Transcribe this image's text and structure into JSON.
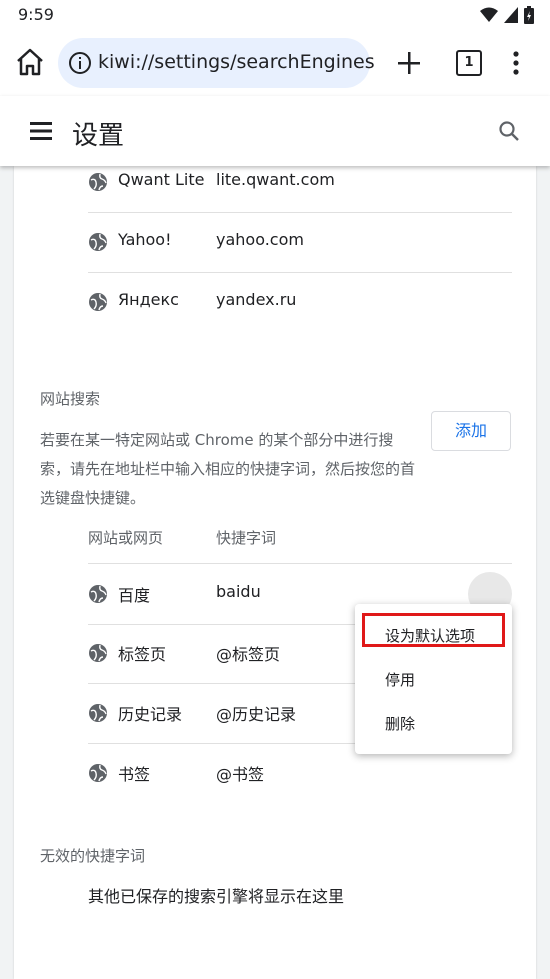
{
  "status_bar": {
    "time": "9:59"
  },
  "toolbar": {
    "url": "kiwi://settings/searchEngines",
    "tab_count": "1"
  },
  "appbar": {
    "title": "设置"
  },
  "default_engines": [
    {
      "name": "Qwant Lite",
      "keyword": "lite.qwant.com"
    },
    {
      "name": "Yahoo!",
      "keyword": "yahoo.com"
    },
    {
      "name": "Яндекс",
      "keyword": "yandex.ru"
    }
  ],
  "site_search": {
    "title": "网站搜索",
    "description": "若要在某一特定网站或 Chrome 的某个部分中进行搜索，请先在地址栏中输入相应的快捷字词，然后按您的首选键盘快捷键。",
    "add_label": "添加",
    "col_site": "网站或网页",
    "col_keyword": "快捷字词",
    "rows": [
      {
        "name": "百度",
        "keyword": "baidu"
      },
      {
        "name": "标签页",
        "keyword": "@标签页"
      },
      {
        "name": "历史记录",
        "keyword": "@历史记录"
      },
      {
        "name": "书签",
        "keyword": "@书签"
      }
    ]
  },
  "inactive": {
    "title": "无效的快捷字词",
    "empty": "其他已保存的搜索引擎将显示在这里"
  },
  "context_menu": {
    "items": [
      "设为默认选项",
      "停用",
      "删除"
    ]
  },
  "colors": {
    "accent": "#1a73e8",
    "highlight": "#e01818",
    "omnibox": "#e8f0fe"
  }
}
